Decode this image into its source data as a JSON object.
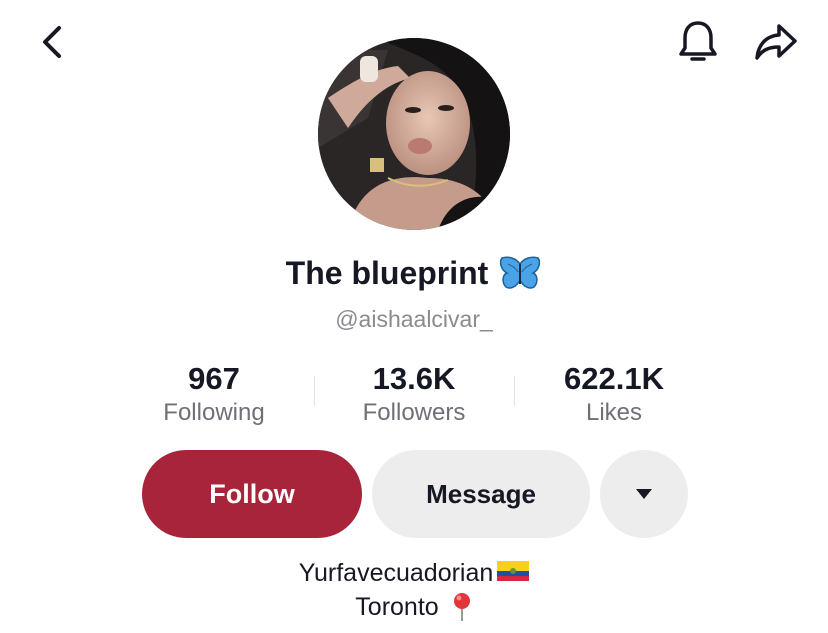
{
  "header": {
    "back_icon": "chevron-left-icon",
    "bell_icon": "bell-icon",
    "share_icon": "share-arrow-icon"
  },
  "profile": {
    "display_name": "The blueprint",
    "name_emoji": "butterfly-icon",
    "username": "@aishaalcivar_"
  },
  "stats": [
    {
      "value": "967",
      "label": "Following"
    },
    {
      "value": "13.6K",
      "label": "Followers"
    },
    {
      "value": "622.1K",
      "label": "Likes"
    }
  ],
  "actions": {
    "follow_label": "Follow",
    "message_label": "Message",
    "more_icon": "triangle-down-icon"
  },
  "bio": {
    "line1": "Yurfavecuadorian",
    "line1_emoji": "ecuador-flag-icon",
    "line2": "Toronto",
    "line2_emoji": "pin-icon"
  },
  "colors": {
    "follow_button": "#a8243a",
    "secondary_button": "#ededee",
    "muted_text": "#8a8b91",
    "butterfly": "#4aa3e6"
  }
}
